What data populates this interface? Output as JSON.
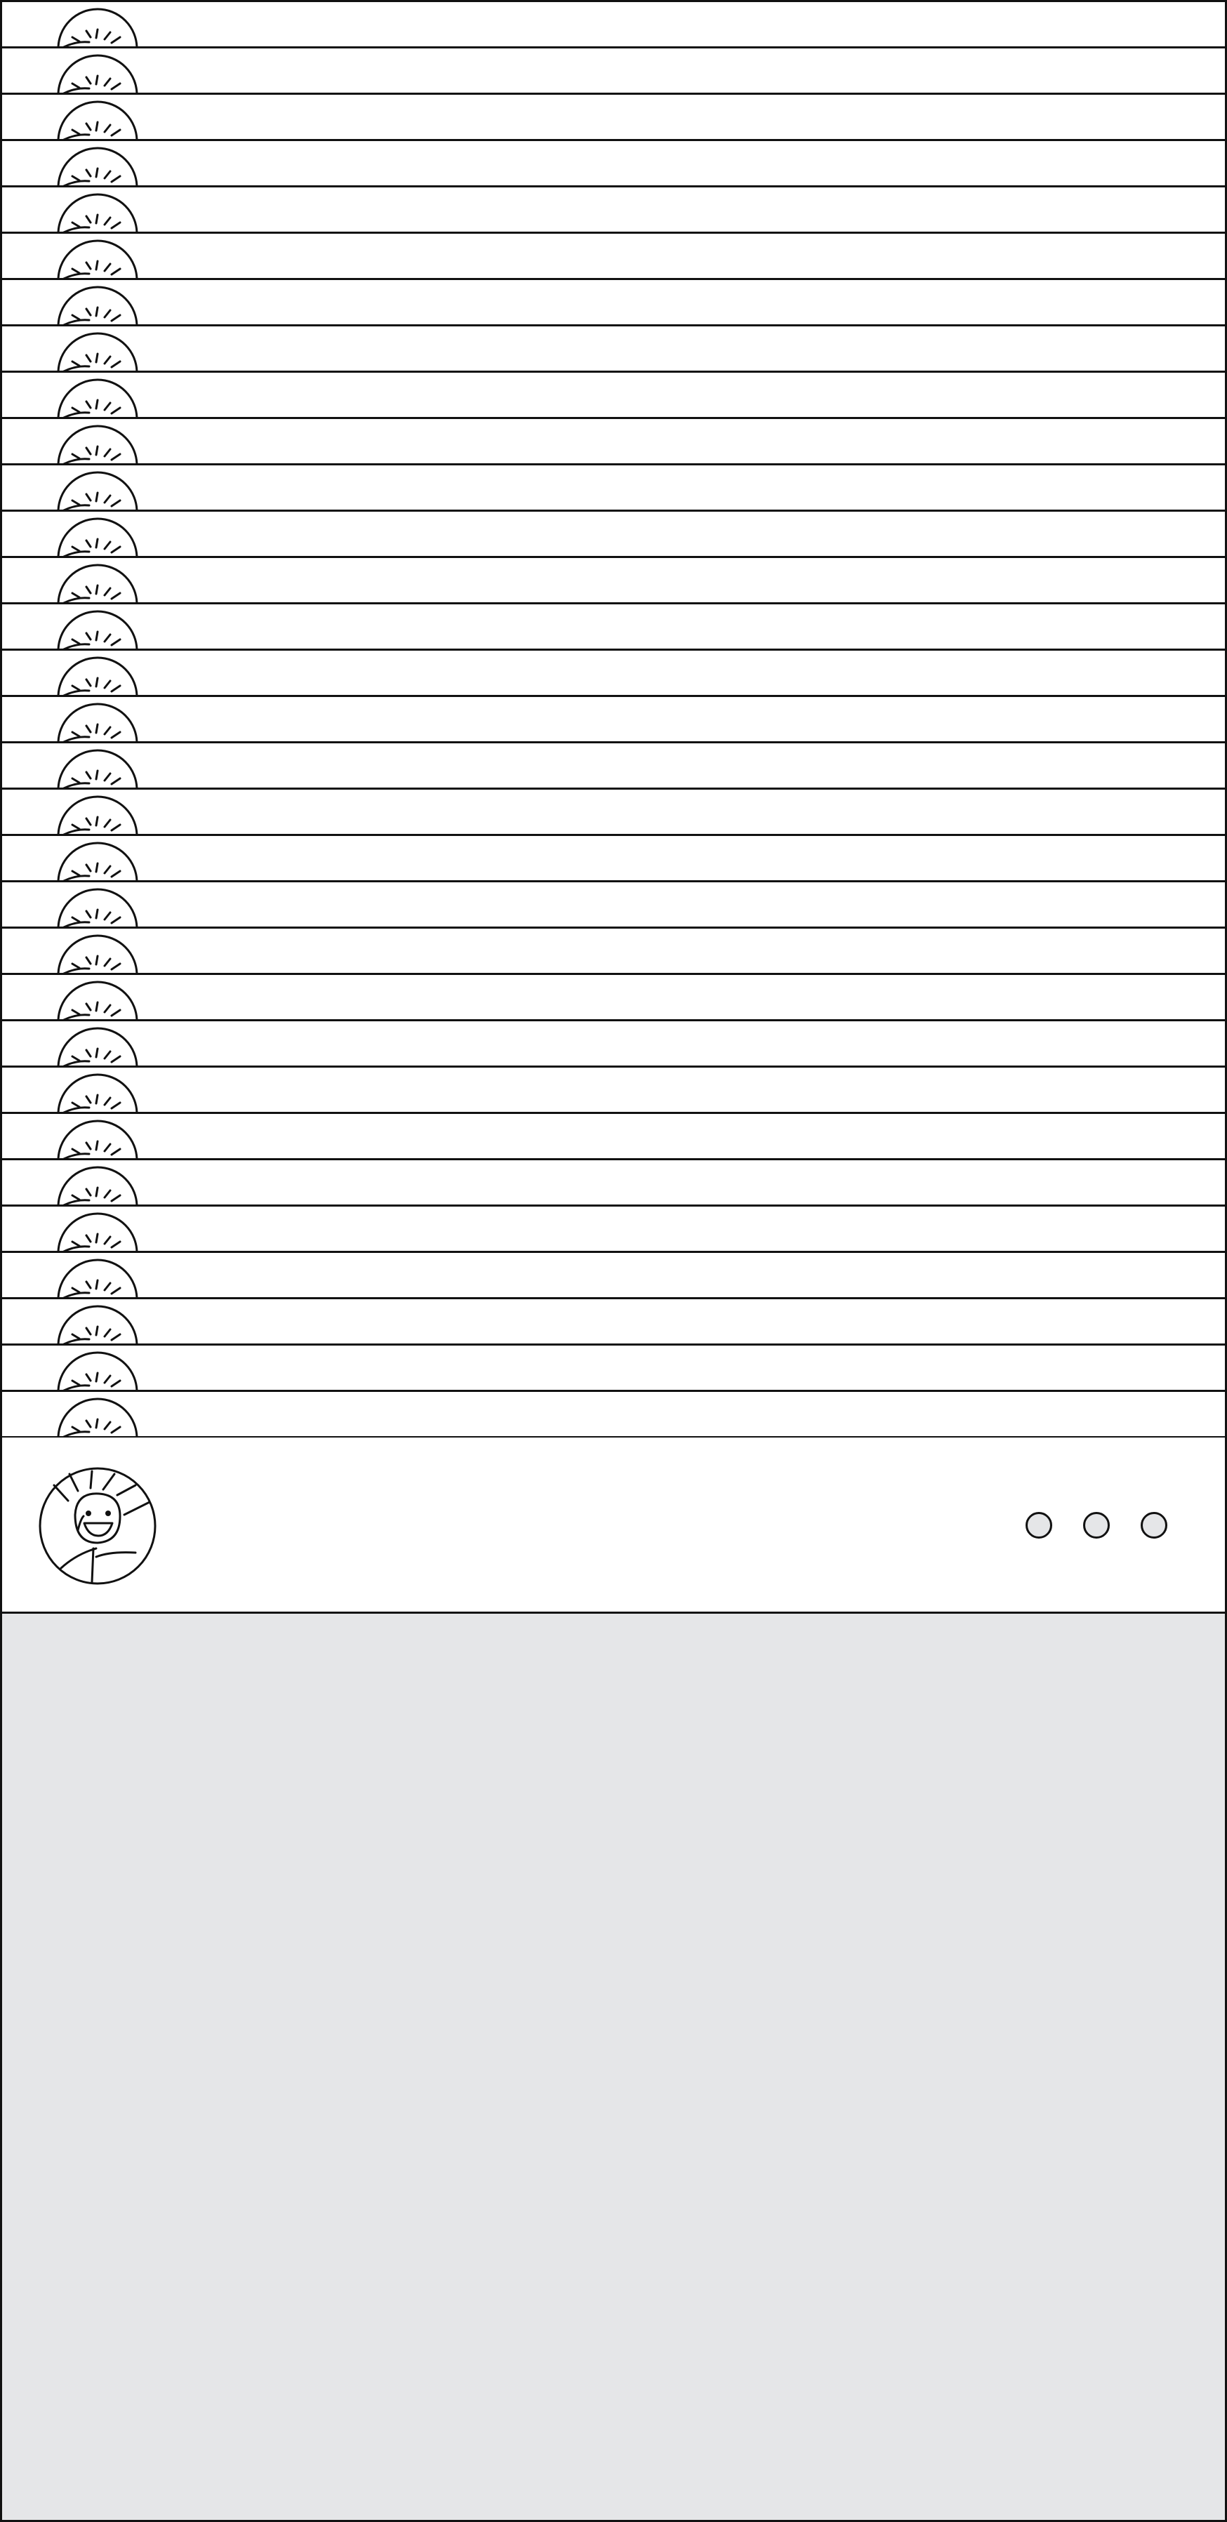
{
  "colors": {
    "outline": "#111111",
    "card_background": "#ffffff",
    "content_background": "#e5e6e8",
    "dot_fill": "#e5e6e8"
  },
  "stack": {
    "row_count": 31,
    "row_icon": "avatar-icon"
  },
  "profile_card": {
    "avatar_icon": "avatar-icon",
    "menu_icon": "more-options-icon"
  }
}
